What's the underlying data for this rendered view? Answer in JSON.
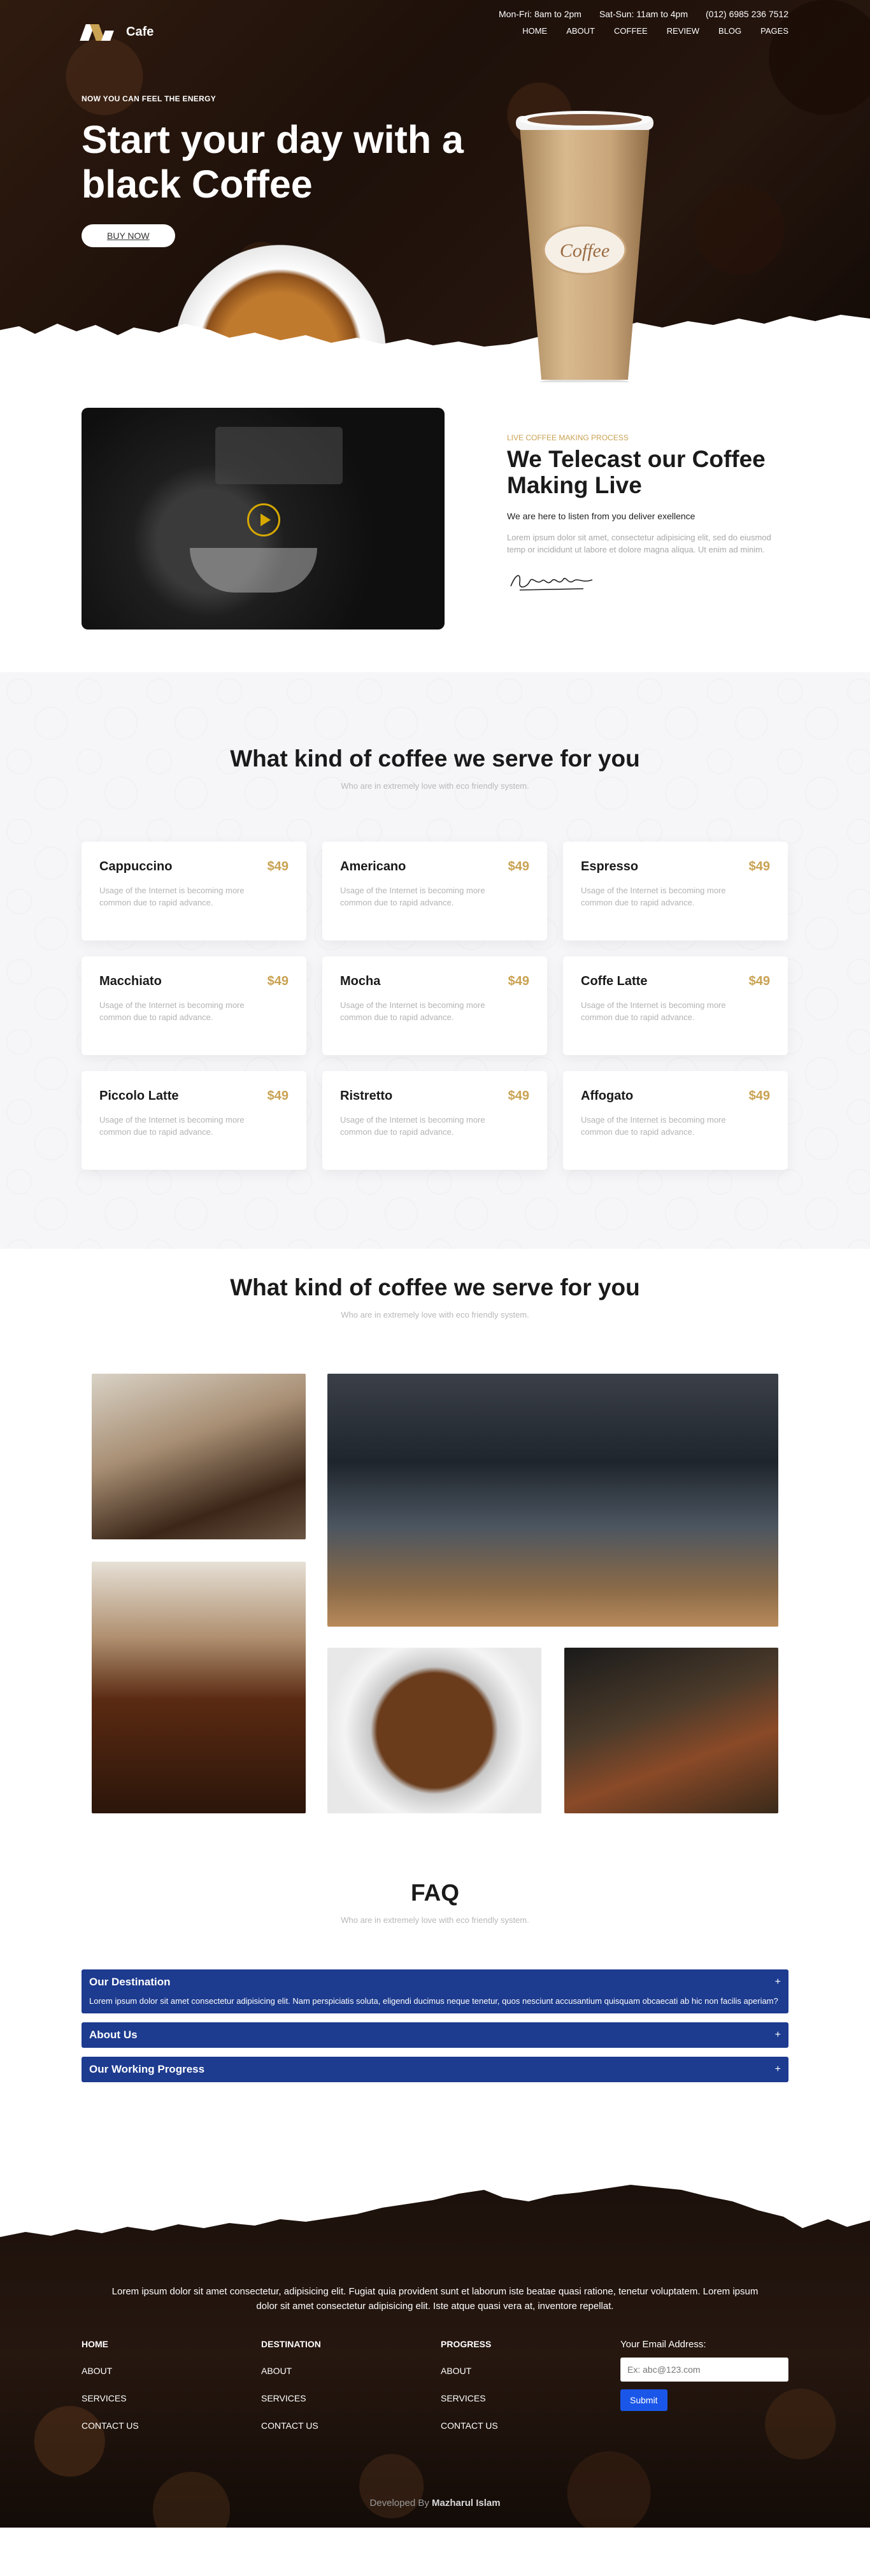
{
  "brand": {
    "name": "Cafe"
  },
  "contact": {
    "weekday": "Mon-Fri: 8am to 2pm",
    "weekend": "Sat-Sun: 11am to 4pm",
    "phone": "(012) 6985 236 7512"
  },
  "nav": [
    "HOME",
    "ABOUT",
    "COFFEE",
    "REVIEW",
    "BLOG",
    "PAGES"
  ],
  "hero": {
    "eyebrow": "NOW YOU CAN FEEL THE ENERGY",
    "title": "Start your day with a black Coffee",
    "button": "BUY NOW",
    "cup_label": "Coffee"
  },
  "live": {
    "eyebrow": "LIVE COFFEE MAKING PROCESS",
    "title": "We Telecast our Coffee Making Live",
    "subtitle": "We are here to listen from you deliver exellence",
    "body": "Lorem ipsum dolor sit amet, consectetur adipisicing elit, sed do eiusmod temp or incididunt ut labore et dolore magna aliqua. Ut enim ad minim."
  },
  "menu": {
    "title": "What kind of coffee we serve for you",
    "subtitle": "Who are in extremely love with eco friendly system.",
    "items": [
      {
        "name": "Cappuccino",
        "price": "$49",
        "desc": "Usage of the Internet is becoming more common due to rapid advance."
      },
      {
        "name": "Americano",
        "price": "$49",
        "desc": "Usage of the Internet is becoming more common due to rapid advance."
      },
      {
        "name": "Espresso",
        "price": "$49",
        "desc": "Usage of the Internet is becoming more common due to rapid advance."
      },
      {
        "name": "Macchiato",
        "price": "$49",
        "desc": "Usage of the Internet is becoming more common due to rapid advance."
      },
      {
        "name": "Mocha",
        "price": "$49",
        "desc": "Usage of the Internet is becoming more common due to rapid advance."
      },
      {
        "name": "Coffe Latte",
        "price": "$49",
        "desc": "Usage of the Internet is becoming more common due to rapid advance."
      },
      {
        "name": "Piccolo Latte",
        "price": "$49",
        "desc": "Usage of the Internet is becoming more common due to rapid advance."
      },
      {
        "name": "Ristretto",
        "price": "$49",
        "desc": "Usage of the Internet is becoming more common due to rapid advance."
      },
      {
        "name": "Affogato",
        "price": "$49",
        "desc": "Usage of the Internet is becoming more common due to rapid advance."
      }
    ]
  },
  "gallery": {
    "title": "What kind of coffee we serve for you",
    "subtitle": "Who are in extremely love with eco friendly system."
  },
  "faq": {
    "title": "FAQ",
    "subtitle": "Who are in extremely love with eco friendly system.",
    "items": [
      {
        "q": "Our Destination",
        "a": "Lorem ipsum dolor sit amet consectetur adipisicing elit. Nam perspiciatis soluta, eligendi ducimus neque tenetur, quos nesciunt accusantium quisquam obcaecati ab hic non facilis aperiam?"
      },
      {
        "q": "About Us",
        "a": ""
      },
      {
        "q": "Our Working Progress",
        "a": ""
      }
    ]
  },
  "footer": {
    "intro": "Lorem ipsum dolor sit amet consectetur, adipisicing elit. Fugiat quia provident sunt et laborum iste beatae quasi ratione, tenetur voluptatem. Lorem ipsum dolor sit amet consectetur adipisicing elit. Iste atque quasi vera at, inventore repellat.",
    "columns": [
      {
        "heading": "HOME",
        "links": [
          "ABOUT",
          "SERVICES",
          "CONTACT US"
        ]
      },
      {
        "heading": "DESTINATION",
        "links": [
          "ABOUT",
          "SERVICES",
          "CONTACT US"
        ]
      },
      {
        "heading": "PROGRESS",
        "links": [
          "ABOUT",
          "SERVICES",
          "CONTACT US"
        ]
      }
    ],
    "subscribe": {
      "label": "Your Email Address:",
      "placeholder": "Ex: abc@123.com",
      "button": "Submit"
    },
    "credit_prefix": "Developed By",
    "credit_name": "Mazharul Islam"
  }
}
